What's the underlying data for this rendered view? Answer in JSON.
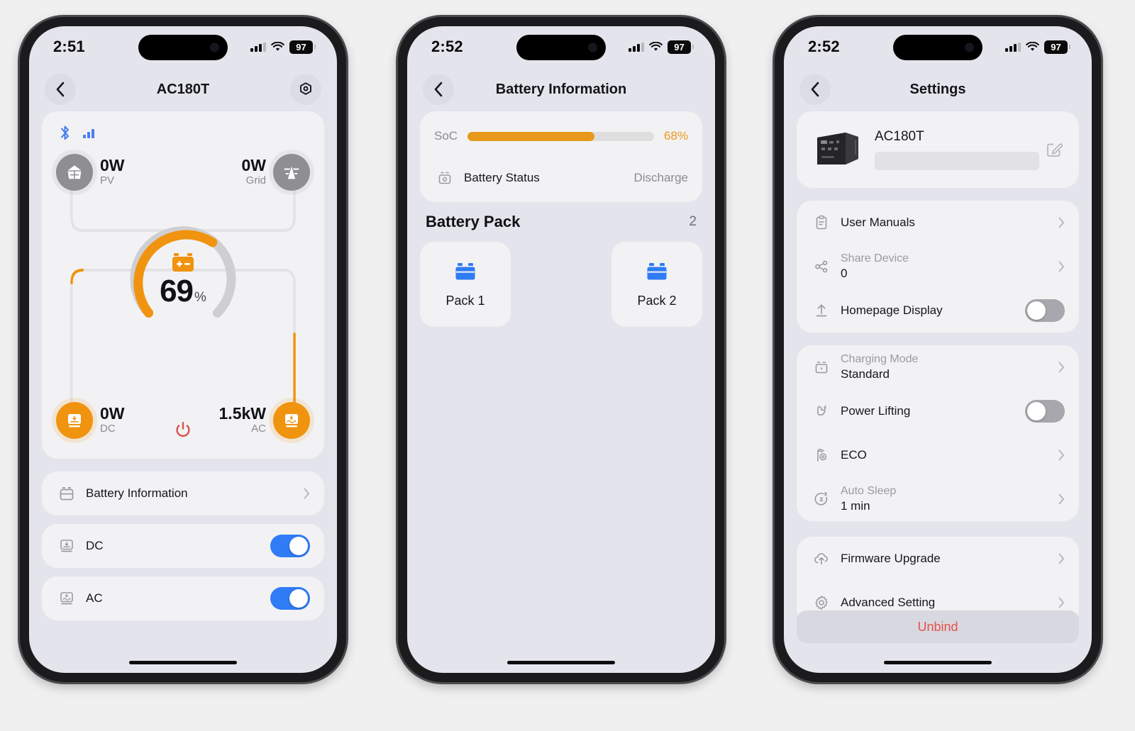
{
  "phone1": {
    "status": {
      "time": "2:51",
      "battery": "97",
      "signal_icon": "cellular-bars-icon",
      "wifi_icon": "wifi-icon"
    },
    "nav": {
      "back_icon": "back-chevron-icon",
      "title": "AC180T",
      "settings_icon": "hex-nut-settings-icon"
    },
    "connectivity": {
      "bluetooth_icon": "bluetooth-icon",
      "signal_icon": "signal-bars-icon"
    },
    "flow": {
      "battery_icon": "battery-icon",
      "percent": "69",
      "percent_unit": "%",
      "nodes": [
        {
          "key": "pv",
          "icon": "solar-panel-icon",
          "value": "0W",
          "label": "PV",
          "state": "inactive"
        },
        {
          "key": "grid",
          "icon": "power-tower-icon",
          "value": "0W",
          "label": "Grid",
          "state": "inactive"
        },
        {
          "key": "dc",
          "icon": "dc-output-icon",
          "value": "0W",
          "label": "DC",
          "state": "active"
        },
        {
          "key": "ac",
          "icon": "ac-output-icon",
          "value": "1.5kW",
          "label": "AC",
          "state": "active"
        }
      ],
      "power_button_icon": "power-icon"
    },
    "list": [
      {
        "icon": "battery-info-icon",
        "label": "Battery Information",
        "control": "chevron"
      },
      {
        "icon": "dc-output-icon",
        "label": "DC",
        "control": "toggle",
        "toggle": "on"
      },
      {
        "icon": "ac-output-icon",
        "label": "AC",
        "control": "toggle",
        "toggle": "on"
      }
    ]
  },
  "phone2": {
    "status": {
      "time": "2:52",
      "battery": "97"
    },
    "nav": {
      "back_icon": "back-chevron-icon",
      "title": "Battery Information"
    },
    "soc": {
      "label": "SoC",
      "percent_text": "68%",
      "percent_value": 68
    },
    "battery_status": {
      "icon": "battery-status-icon",
      "label": "Battery Status",
      "value": "Discharge"
    },
    "pack_section": {
      "title": "Battery Pack",
      "count": "2"
    },
    "packs": [
      {
        "icon": "battery-pack-icon",
        "label": "Pack 1"
      },
      {
        "icon": "battery-pack-icon",
        "label": "Pack 2"
      }
    ]
  },
  "phone3": {
    "status": {
      "time": "2:52",
      "battery": "97"
    },
    "nav": {
      "back_icon": "back-chevron-icon",
      "title": "Settings"
    },
    "device": {
      "image": "power-station-photo",
      "name": "AC180T",
      "redacted_field": "",
      "edit_icon": "edit-pencil-icon"
    },
    "group1": [
      {
        "icon": "clipboard-icon",
        "label": "User Manuals",
        "control": "chevron"
      },
      {
        "icon": "share-icon",
        "label": "Share Device",
        "value": "0",
        "control": "chevron",
        "style": "two-line"
      },
      {
        "icon": "upload-icon",
        "label": "Homepage Display",
        "control": "toggle",
        "toggle": "off"
      }
    ],
    "group2": [
      {
        "icon": "charging-mode-icon",
        "label": "Charging Mode",
        "value": "Standard",
        "control": "chevron",
        "style": "two-line"
      },
      {
        "icon": "power-lifting-icon",
        "label": "Power Lifting",
        "control": "toggle",
        "toggle": "off"
      },
      {
        "icon": "eco-icon",
        "label": "ECO",
        "control": "chevron"
      },
      {
        "icon": "auto-sleep-icon",
        "label": "Auto Sleep",
        "value": "1 min",
        "control": "chevron",
        "style": "two-line"
      }
    ],
    "group3": [
      {
        "icon": "firmware-upgrade-icon",
        "label": "Firmware Upgrade",
        "control": "chevron"
      },
      {
        "icon": "gear-icon",
        "label": "Advanced Setting",
        "control": "chevron"
      }
    ],
    "unbind_label": "Unbind"
  },
  "colors": {
    "accent_orange": "#f0930f",
    "soc_orange": "#e8991a",
    "toggle_on_blue": "#2f7cf6",
    "toggle_off_gray": "#a7a7ad",
    "unbind_red": "#e6514e",
    "inactive_gray": "#8e8e93",
    "app_bg": "#e4e4ec",
    "card_bg": "#f2f2f4"
  }
}
